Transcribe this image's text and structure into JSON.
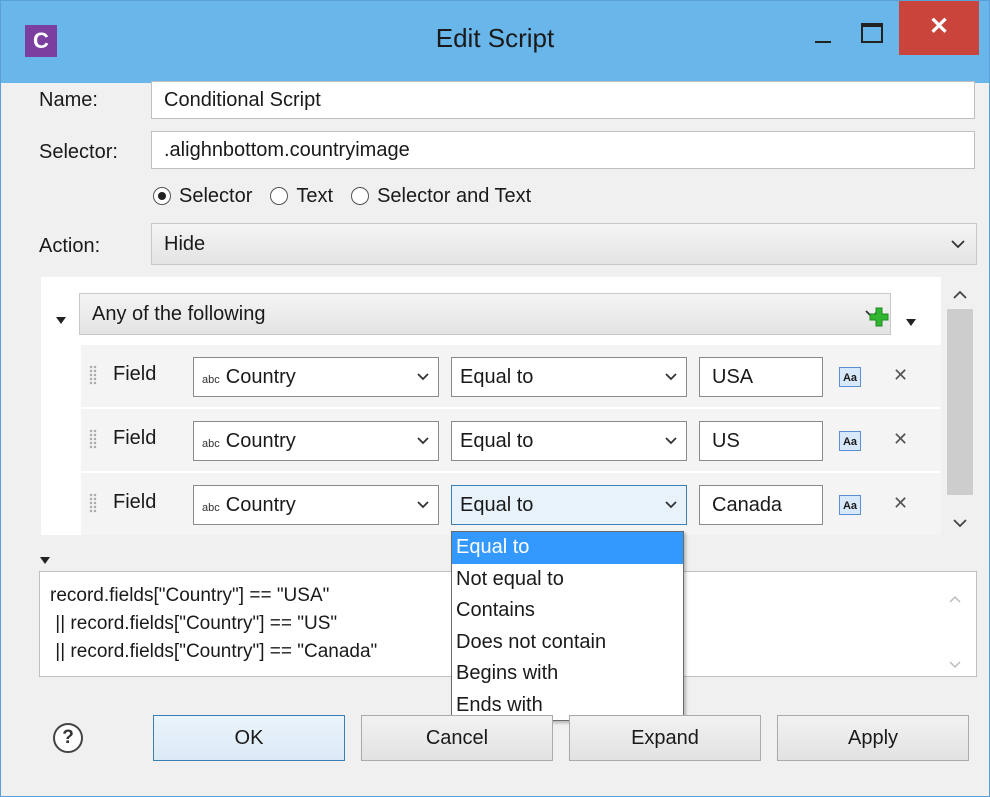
{
  "window": {
    "title": "Edit Script",
    "app_icon_letter": "C",
    "close_glyph": "✕"
  },
  "form": {
    "name_label": "Name:",
    "name_value": "Conditional Script",
    "selector_label": "Selector:",
    "selector_value": ".alighnbottom.countryimage",
    "radios": [
      {
        "label": "Selector",
        "checked": true
      },
      {
        "label": "Text",
        "checked": false
      },
      {
        "label": "Selector and Text",
        "checked": false
      }
    ],
    "action_label": "Action:",
    "action_value": "Hide"
  },
  "rules": {
    "group_mode": "Any of the following",
    "rows": [
      {
        "kind": "Field",
        "field_type": "abc",
        "field": "Country",
        "operator": "Equal to",
        "value": "USA",
        "case_icon": "Aa",
        "remove_glyph": "✕"
      },
      {
        "kind": "Field",
        "field_type": "abc",
        "field": "Country",
        "operator": "Equal to",
        "value": "US",
        "case_icon": "Aa",
        "remove_glyph": "✕"
      },
      {
        "kind": "Field",
        "field_type": "abc",
        "field": "Country",
        "operator": "Equal to",
        "value": "Canada",
        "case_icon": "Aa",
        "remove_glyph": "✕"
      }
    ]
  },
  "operator_dropdown": {
    "options": [
      "Equal to",
      "Not equal to",
      "Contains",
      "Does not contain",
      "Begins with",
      "Ends with"
    ],
    "highlighted_index": 0
  },
  "code": {
    "lines": [
      "record.fields[\"Country\"] == \"USA\"",
      " || record.fields[\"Country\"] == \"US\"",
      " || record.fields[\"Country\"] == \"Canada\""
    ]
  },
  "buttons": {
    "help": "?",
    "ok": "OK",
    "cancel": "Cancel",
    "expand": "Expand",
    "apply": "Apply"
  },
  "colors": {
    "titlebar": "#69b7ea",
    "close": "#c9453b",
    "app_icon": "#7b3fa0",
    "highlight": "#3399ff",
    "add_icon": "#2fb52f"
  }
}
